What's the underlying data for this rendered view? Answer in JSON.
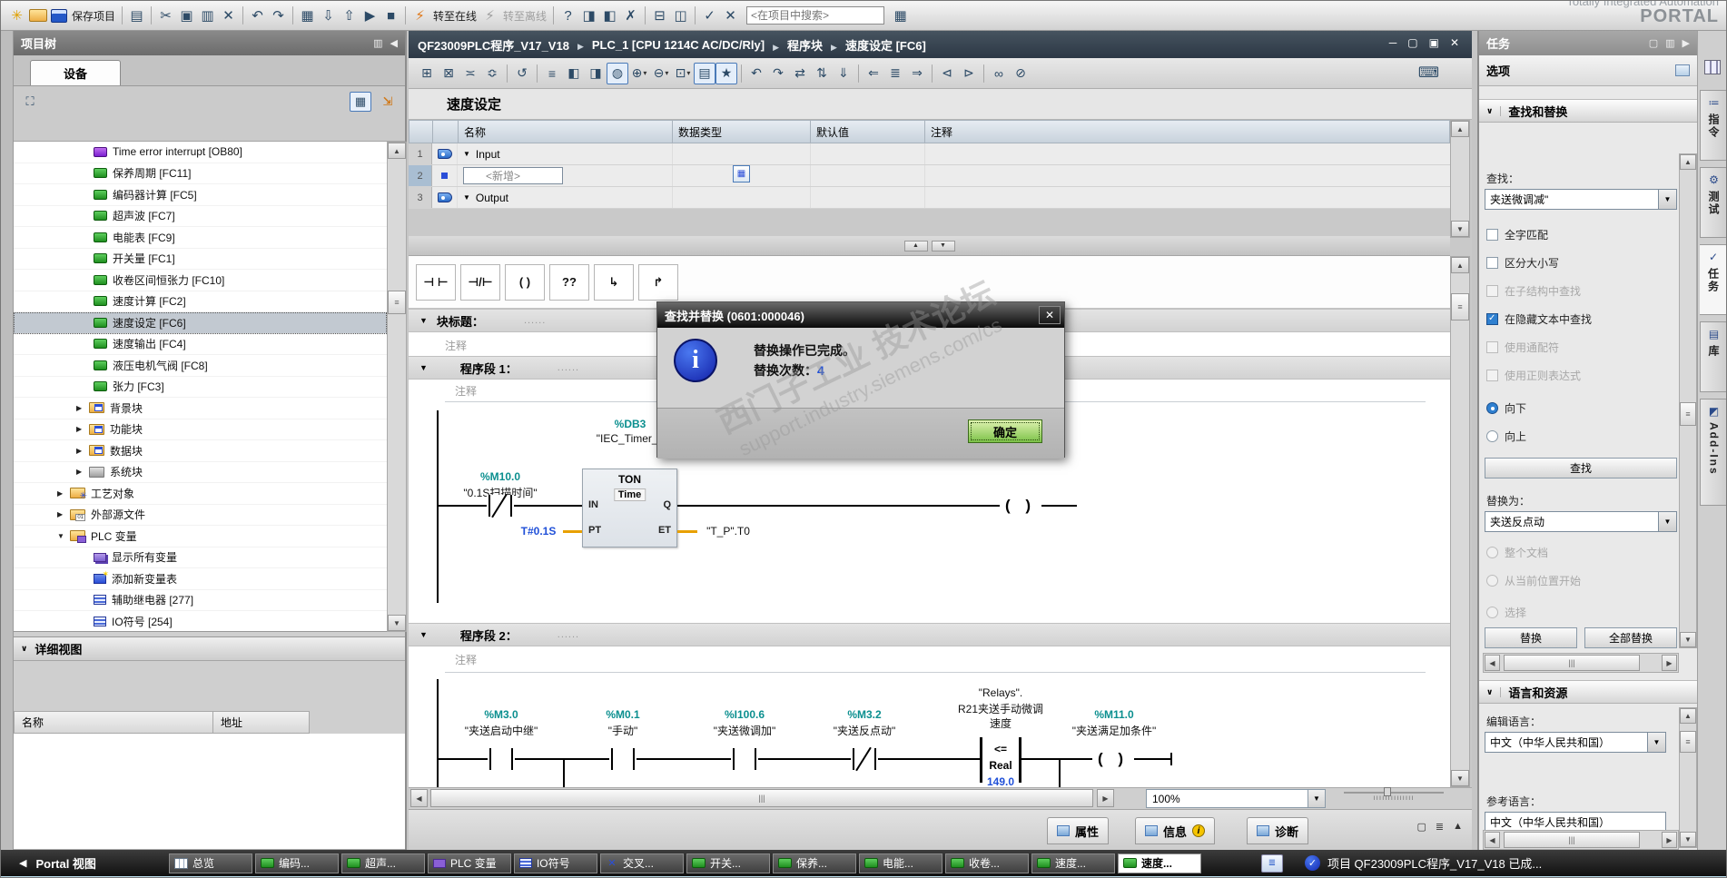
{
  "brand": {
    "line1": "Totally Integrated Automation",
    "line2": "PORTAL"
  },
  "top_toolbar": {
    "items": [
      {
        "icon": "new-project-icon",
        "text": "✳",
        "state": "accent"
      },
      {
        "icon": "open-project-icon",
        "state": "folder"
      },
      {
        "icon": "save-project-icon",
        "state": "floppy"
      },
      {
        "state": "label",
        "text": "保存项目"
      },
      {
        "state": "sep"
      },
      {
        "icon": "print-icon",
        "text": "▤"
      },
      {
        "state": "sep"
      },
      {
        "icon": "cut-icon",
        "text": "✂"
      },
      {
        "icon": "copy-icon",
        "text": "▣"
      },
      {
        "icon": "paste-icon",
        "text": "▥"
      },
      {
        "icon": "delete-icon",
        "text": "✕"
      },
      {
        "state": "sep"
      },
      {
        "icon": "undo-icon",
        "text": "↶",
        "state": "drop"
      },
      {
        "icon": "redo-icon",
        "text": "↷",
        "state": "drop"
      },
      {
        "state": "sep"
      },
      {
        "icon": "compile-icon",
        "text": "▦"
      },
      {
        "icon": "download-to-device-icon",
        "text": "⇩"
      },
      {
        "icon": "upload-from-device-icon",
        "text": "⇧"
      },
      {
        "icon": "start-cpu-icon",
        "text": "▶"
      },
      {
        "icon": "stop-cpu-icon",
        "text": "■"
      },
      {
        "state": "sep"
      },
      {
        "icon": "go-online-icon",
        "text": "⚡",
        "state": "online"
      },
      {
        "state": "label",
        "text": "转至在线"
      },
      {
        "icon": "go-offline-icon",
        "text": "⚡",
        "state": "dim"
      },
      {
        "state": "label dim",
        "text": "转至离线"
      },
      {
        "state": "sep"
      },
      {
        "icon": "accessible-devices-icon",
        "text": "?"
      },
      {
        "icon": "start-simulation-icon",
        "text": "◨"
      },
      {
        "icon": "stop-simulation-icon",
        "text": "◧"
      },
      {
        "icon": "detach-icon",
        "text": "✗"
      },
      {
        "state": "sep"
      },
      {
        "icon": "split-horizontal-icon",
        "text": "⊟"
      },
      {
        "icon": "split-vertical-icon",
        "text": "◫"
      },
      {
        "state": "sep"
      },
      {
        "icon": "online-check-icon",
        "text": "✓"
      },
      {
        "icon": "online-cross-icon",
        "text": "✕"
      }
    ],
    "search_placeholder": "<在项目中搜索>",
    "tail_icon_glyph": "▦"
  },
  "breadcrumb": {
    "items": [
      "QF23009PLC程序_V17_V18",
      "PLC_1 [CPU 1214C AC/DC/Rly]",
      "程序块",
      "速度设定 [FC6]"
    ]
  },
  "project_tree": {
    "title": "项目树",
    "device_tab": "设备",
    "items": [
      {
        "label": "Time error interrupt [OB80]",
        "icon": "ob-block-icon",
        "state": "lvl3"
      },
      {
        "label": "保养周期 [FC11]",
        "icon": "fc-block-icon",
        "state": "lvl3"
      },
      {
        "label": "编码器计算 [FC5]",
        "icon": "fc-block-icon",
        "state": "lvl3"
      },
      {
        "label": "超声波 [FC7]",
        "icon": "fc-block-icon",
        "state": "lvl3"
      },
      {
        "label": "电能表 [FC9]",
        "icon": "fc-block-icon",
        "state": "lvl3"
      },
      {
        "label": "开关量 [FC1]",
        "icon": "fc-block-icon",
        "state": "lvl3"
      },
      {
        "label": "收卷区间恒张力 [FC10]",
        "icon": "fc-block-icon",
        "state": "lvl3"
      },
      {
        "label": "速度计算 [FC2]",
        "icon": "fc-block-icon",
        "state": "lvl3"
      },
      {
        "label": "速度设定 [FC6]",
        "icon": "fc-block-icon",
        "state": "lvl3 selected"
      },
      {
        "label": "速度输出 [FC4]",
        "icon": "fc-block-icon",
        "state": "lvl3"
      },
      {
        "label": "液压电机气阀 [FC8]",
        "icon": "fc-block-icon",
        "state": "lvl3"
      },
      {
        "label": "张力 [FC3]",
        "icon": "fc-block-icon",
        "state": "lvl3"
      },
      {
        "label": "背景块",
        "icon": "blocks-folder-icon",
        "state": "lvl2 col"
      },
      {
        "label": "功能块",
        "icon": "blocks-folder-icon",
        "state": "lvl2 col"
      },
      {
        "label": "数据块",
        "icon": "blocks-folder-icon",
        "state": "lvl2 col"
      },
      {
        "label": "系统块",
        "icon": "system-folder-icon",
        "state": "lvl2 col"
      },
      {
        "label": "工艺对象",
        "icon": "tech-folder-icon",
        "state": "lvl1 col"
      },
      {
        "label": "外部源文件",
        "icon": "ext-src-folder-icon",
        "state": "lvl1 col"
      },
      {
        "label": "PLC 变量",
        "icon": "plc-tags-folder-icon",
        "state": "lvl1 exp"
      },
      {
        "label": "显示所有变量",
        "icon": "show-all-tags-icon",
        "state": "lvl3"
      },
      {
        "label": "添加新变量表",
        "icon": "add-tag-table-icon",
        "state": "lvl3"
      },
      {
        "label": "辅助继电器 [277]",
        "icon": "tag-table-icon",
        "state": "lvl3"
      },
      {
        "label": "IO符号 [254]",
        "icon": "tag-table-icon",
        "state": "lvl3"
      }
    ]
  },
  "detail_view": {
    "title": "详细视图",
    "columns": [
      "名称",
      "地址"
    ]
  },
  "editor": {
    "toolbar_items": [
      {
        "icon": "insert-row-icon",
        "glyph": "⊞"
      },
      {
        "icon": "delete-row-icon",
        "glyph": "⊠"
      },
      {
        "icon": "snapshot-icon",
        "glyph": "≍"
      },
      {
        "icon": "apply-snapshot-icon",
        "glyph": "≎"
      },
      {
        "state": "sep"
      },
      {
        "icon": "reset-start-values-icon",
        "glyph": "↺"
      },
      {
        "state": "sep"
      },
      {
        "icon": "absolute-operands-icon",
        "glyph": "≡"
      },
      {
        "icon": "expand-networks-icon",
        "glyph": "◧"
      },
      {
        "icon": "collapse-networks-icon",
        "glyph": "◨"
      },
      {
        "icon": "comments-toggle-icon",
        "glyph": "◍",
        "state": "sel"
      },
      {
        "icon": "add-network-icon",
        "glyph": "⊕",
        "state": "drop"
      },
      {
        "icon": "delete-network-icon",
        "glyph": "⊖",
        "state": "drop"
      },
      {
        "icon": "insert-box-icon",
        "glyph": "⊡",
        "state": "drop"
      },
      {
        "icon": "favorites-toggle-icon",
        "glyph": "▤",
        "state": "sel"
      },
      {
        "icon": "star-icon",
        "glyph": "★",
        "state": "sel"
      },
      {
        "state": "sep"
      },
      {
        "icon": "undo-jump-icon",
        "glyph": "↶"
      },
      {
        "icon": "redo-jump-icon",
        "glyph": "↷"
      },
      {
        "icon": "update-calls-icon",
        "glyph": "⇄"
      },
      {
        "icon": "consistency-icon",
        "glyph": "⇅"
      },
      {
        "icon": "download-block-icon",
        "glyph": "⇓"
      },
      {
        "state": "sep"
      },
      {
        "icon": "monitor-back-icon",
        "glyph": "⇐"
      },
      {
        "icon": "monitor-line-icon",
        "glyph": "≣"
      },
      {
        "icon": "monitor-fwd-icon",
        "glyph": "⇒"
      },
      {
        "state": "sep"
      },
      {
        "icon": "goto-prev-icon",
        "glyph": "⊲"
      },
      {
        "icon": "goto-next-icon",
        "glyph": "⊳"
      },
      {
        "state": "sep"
      },
      {
        "icon": "glasses-icon",
        "glyph": "∞"
      },
      {
        "icon": "lock-icon",
        "glyph": "⊘"
      }
    ],
    "keyboard_glyph": "⌨",
    "block_name": "速度设定",
    "table": {
      "headers": [
        "名称",
        "数据类型",
        "默认值",
        "注释"
      ],
      "rows": [
        {
          "num": "1",
          "label": "Input"
        },
        {
          "num": "2",
          "label": "<新增>"
        },
        {
          "num": "3",
          "label": "Output"
        }
      ]
    },
    "favorites": [
      {
        "icon": "no-contact-icon",
        "glyph": "⊣ ⊢"
      },
      {
        "icon": "nc-contact-icon",
        "glyph": "⊣/⊢"
      },
      {
        "icon": "coil-icon",
        "glyph": "( )"
      },
      {
        "icon": "empty-box-icon",
        "glyph": "??"
      },
      {
        "icon": "open-branch-icon",
        "glyph": "↳"
      },
      {
        "icon": "close-branch-icon",
        "glyph": "↱"
      }
    ],
    "block_title_label": "块标题：",
    "dots": "......",
    "comment_placeholder": "注释",
    "network1_label": "程序段 1：",
    "network2_label": "程序段 2：",
    "zoom_value": "100%"
  },
  "ladder": {
    "net1": {
      "contact_addr": "%M10.0",
      "contact_name": "\"0.1S扫描时间\"",
      "db": "%DB3",
      "instance": "\"IEC_Timer_0",
      "block_type": "TON",
      "block_dtype": "Time",
      "pin_in": "IN",
      "pin_q": "Q",
      "pin_pt": "PT",
      "pin_et": "ET",
      "pt_value": "T#0.1S",
      "et_value": "\"T_P\".T0"
    },
    "net2": {
      "c1_addr": "%M3.0",
      "c1_name": "\"夹送启动中继\"",
      "c2_addr": "%M0.1",
      "c2_name": "\"手动\"",
      "c3_addr": "%I100.6",
      "c3_name": "\"夹送微调加\"",
      "c4_addr": "%M3.2",
      "c4_name": "\"夹送反点动\"",
      "cmp_operand": "\"Relays\".",
      "cmp_name1": "R21夹送手动微调",
      "cmp_name2": "速度",
      "cmp_op": "<=",
      "cmp_type": "Real",
      "cmp_value": "149.0",
      "coil_addr": "%M11.0",
      "coil_name": "\"夹送满足加条件\""
    }
  },
  "dialog": {
    "title": "查找并替换 (0601:000046)",
    "message1": "替换操作已完成。",
    "message2": "替换次数：",
    "count": "4",
    "ok": "确定"
  },
  "watermark": {
    "line1": "西门子工业  技术论坛",
    "line2": "support.industry.siemens.com/cs"
  },
  "tasks": {
    "title": "任务",
    "options_label": "选项",
    "find_replace": {
      "header": "查找和替换",
      "find_label": "查找：",
      "find_value": "夹送微调减\"",
      "checks": [
        {
          "label": "全字匹配",
          "state": "none"
        },
        {
          "label": "区分大小写",
          "state": "none"
        },
        {
          "label": "在子结构中查找",
          "state": "disabled"
        },
        {
          "label": "在隐藏文本中查找",
          "state": "checked"
        },
        {
          "label": "使用通配符",
          "state": "disabled"
        },
        {
          "label": "使用正则表达式",
          "state": "disabled"
        }
      ],
      "direction": [
        {
          "label": "向下",
          "state": "selected"
        },
        {
          "label": "向上",
          "state": "none"
        }
      ],
      "find_button": "查找",
      "replace_label": "替换为：",
      "replace_value": "夹送反点动",
      "scope": [
        {
          "label": "整个文档",
          "state": "disabled"
        },
        {
          "label": "从当前位置开始",
          "state": "disabled"
        },
        {
          "label": "选择",
          "state": "disabled"
        }
      ],
      "replace_button": "替换",
      "replace_all_button": "全部替换"
    },
    "languages": {
      "header": "语言和资源",
      "edit_label": "编辑语言：",
      "edit_value": "中文（中华人民共和国）",
      "ref_label": "参考语言：",
      "ref_value": "中文（中华人民共和国）"
    }
  },
  "right_tabs": {
    "items": [
      {
        "label": "指令",
        "icon": "instructions-icon",
        "glyph": "≔"
      },
      {
        "label": "测试",
        "icon": "testing-icon",
        "glyph": "⚙"
      },
      {
        "label": "任务",
        "icon": "tasks-icon",
        "glyph": "✓",
        "state": "active"
      },
      {
        "label": "库",
        "icon": "libraries-icon",
        "glyph": "▤"
      },
      {
        "label": "Add-Ins",
        "icon": "addins-icon",
        "glyph": "◩"
      }
    ]
  },
  "inspector": {
    "properties": "属性",
    "info": "信息",
    "diagnostics": "诊断"
  },
  "taskbar": {
    "portal": "Portal 视图",
    "buttons": [
      {
        "label": "总览",
        "icon": "overview-icon"
      },
      {
        "label": "编码...",
        "icon": "fc-block-icon"
      },
      {
        "label": "超声...",
        "icon": "fc-block-icon"
      },
      {
        "label": "PLC 变量",
        "icon": "plc-tags-icon"
      },
      {
        "label": "IO符号",
        "icon": "tag-table-icon"
      },
      {
        "label": "交叉...",
        "icon": "cross-ref-icon"
      },
      {
        "label": "开关...",
        "icon": "fc-block-icon"
      },
      {
        "label": "保养...",
        "icon": "fc-block-icon"
      },
      {
        "label": "电能...",
        "icon": "fc-block-icon"
      },
      {
        "label": "收卷...",
        "icon": "fc-block-icon"
      },
      {
        "label": "速度...",
        "icon": "fc-block-icon"
      },
      {
        "label": "速度...",
        "icon": "fc-block-icon",
        "state": "active"
      }
    ],
    "status": "项目 QF23009PLC程序_V17_V18 已成..."
  }
}
